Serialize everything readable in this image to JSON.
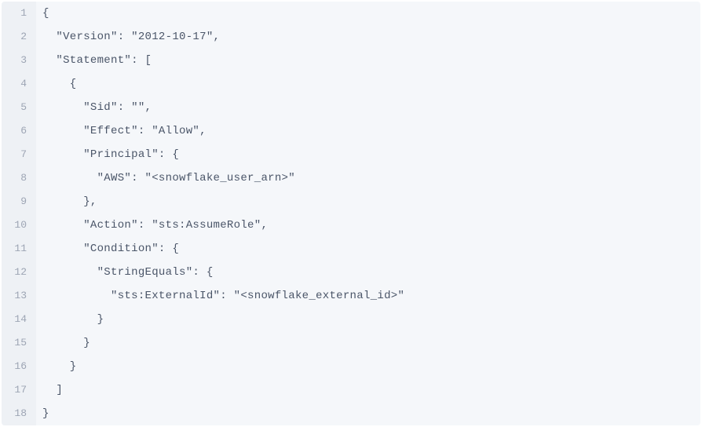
{
  "code": {
    "lines": [
      {
        "num": "1",
        "content": "{"
      },
      {
        "num": "2",
        "content": "  \"Version\": \"2012-10-17\","
      },
      {
        "num": "3",
        "content": "  \"Statement\": ["
      },
      {
        "num": "4",
        "content": "    {"
      },
      {
        "num": "5",
        "content": "      \"Sid\": \"\","
      },
      {
        "num": "6",
        "content": "      \"Effect\": \"Allow\","
      },
      {
        "num": "7",
        "content": "      \"Principal\": {"
      },
      {
        "num": "8",
        "content": "        \"AWS\": \"<snowflake_user_arn>\""
      },
      {
        "num": "9",
        "content": "      },"
      },
      {
        "num": "10",
        "content": "      \"Action\": \"sts:AssumeRole\","
      },
      {
        "num": "11",
        "content": "      \"Condition\": {"
      },
      {
        "num": "12",
        "content": "        \"StringEquals\": {"
      },
      {
        "num": "13",
        "content": "          \"sts:ExternalId\": \"<snowflake_external_id>\""
      },
      {
        "num": "14",
        "content": "        }"
      },
      {
        "num": "15",
        "content": "      }"
      },
      {
        "num": "16",
        "content": "    }"
      },
      {
        "num": "17",
        "content": "  ]"
      },
      {
        "num": "18",
        "content": "}"
      }
    ]
  },
  "policy_json": {
    "Version": "2012-10-17",
    "Statement": [
      {
        "Sid": "",
        "Effect": "Allow",
        "Principal": {
          "AWS": "<snowflake_user_arn>"
        },
        "Action": "sts:AssumeRole",
        "Condition": {
          "StringEquals": {
            "sts:ExternalId": "<snowflake_external_id>"
          }
        }
      }
    ]
  }
}
